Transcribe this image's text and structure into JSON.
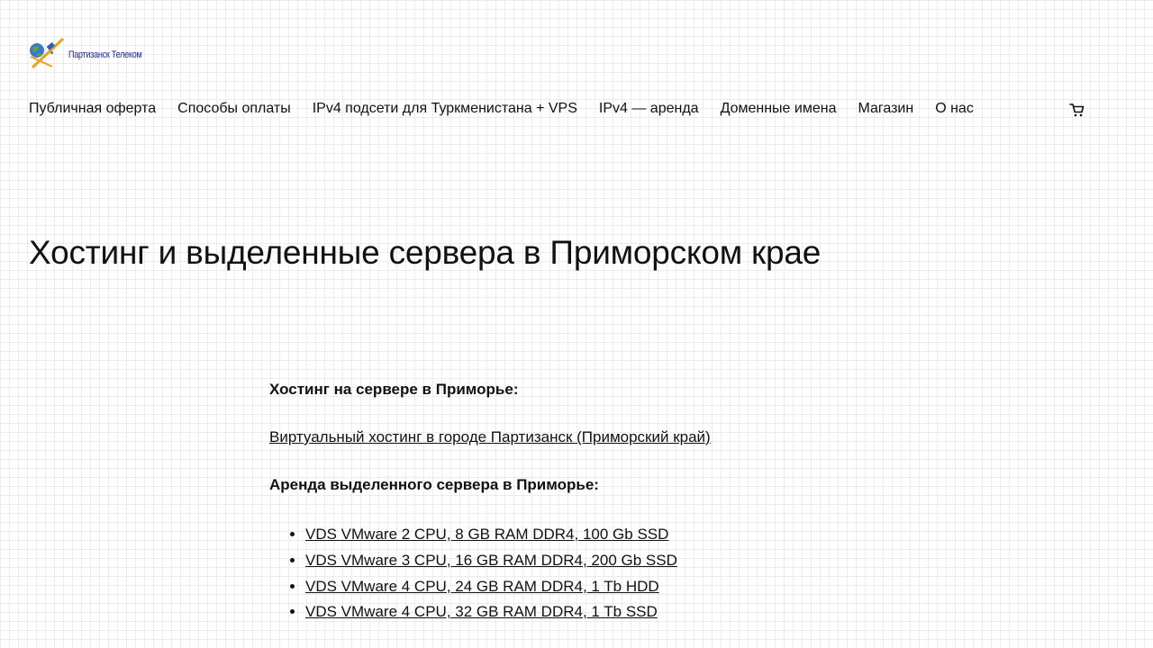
{
  "header": {
    "logo_text": "Партизанск Телеком"
  },
  "nav": {
    "items": [
      "Публичная оферта",
      "Способы оплаты",
      "IPv4 подсети для Туркменистана + VPS",
      "IPv4 — аренда",
      "Доменные имена",
      "Магазин",
      "О нас"
    ],
    "cart_icon": "cart-icon"
  },
  "main": {
    "title": "Хостинг и выделенные сервера в Приморском крае",
    "hosting_heading": "Хостинг на сервере в Приморье:",
    "hosting_link": "Виртуальный хостинг в городе Партизанск (Приморский край)",
    "servers_heading": "Аренда выделенного сервера в Приморье:",
    "servers": [
      "VDS VMware 2 CPU, 8 GB RAM DDR4, 100 Gb SSD",
      "VDS VMware 3 CPU, 16 GB RAM DDR4, 200 Gb SSD",
      "VDS VMware 4 CPU, 24 GB RAM DDR4, 1 Tb HDD",
      "VDS VMware 4 CPU, 32 GB RAM DDR4, 1 Tb SSD"
    ]
  },
  "colors": {
    "text": "#111111",
    "logo_text": "#1b2a8f",
    "grid": "#ececec"
  }
}
